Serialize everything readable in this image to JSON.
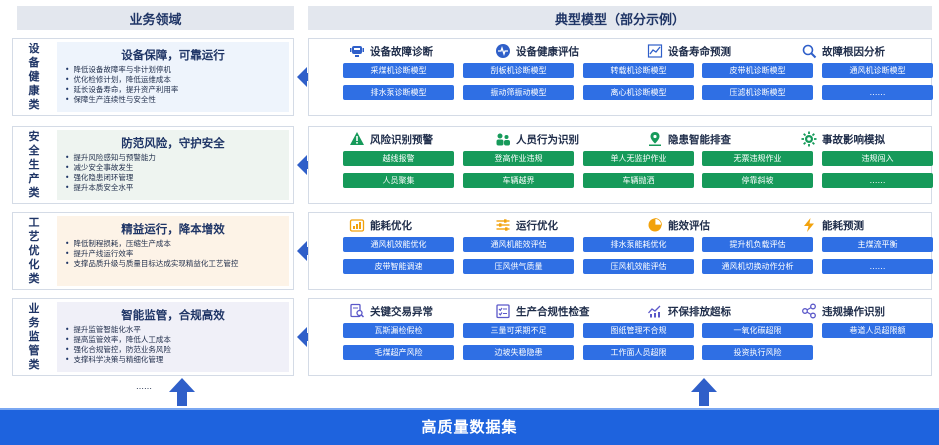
{
  "headers": {
    "left": "业务领域",
    "right": "典型模型（部分示例）"
  },
  "rows": [
    {
      "category": "设备健康类",
      "title": "设备保障，可靠运行",
      "bullets": [
        "降低设备故障率与非计划停机",
        "优化检修计划，降低运维成本",
        "延长设备寿命，提升资产利用率",
        "保障生产连续性与安全性"
      ],
      "theme": "blue",
      "models": [
        {
          "label": "设备故障诊断",
          "icon": "monitor-alert-icon"
        },
        {
          "label": "设备健康评估",
          "icon": "heartbeat-icon"
        },
        {
          "label": "设备寿命预测",
          "icon": "line-chart-icon"
        },
        {
          "label": "故障根因分析",
          "icon": "magnifier-icon"
        }
      ],
      "tags": [
        "采煤机诊断模型",
        "刮板机诊断模型",
        "转载机诊断模型",
        "皮带机诊断模型",
        "通风机诊断模型",
        "排水泵诊断模型",
        "振动筛振动模型",
        "离心机诊断模型",
        "压滤机诊断模型",
        "……"
      ]
    },
    {
      "category": "安全生产类",
      "title": "防范风险，守护安全",
      "bullets": [
        "提升风险感知与预警能力",
        "减少安全事故发生",
        "强化隐患闭环管理",
        "提升本质安全水平"
      ],
      "theme": "green",
      "models": [
        {
          "label": "风险识别预警",
          "icon": "warning-icon"
        },
        {
          "label": "人员行为识别",
          "icon": "people-icon"
        },
        {
          "label": "隐患智能排查",
          "icon": "map-pin-icon"
        },
        {
          "label": "事故影响模拟",
          "icon": "gear-burst-icon"
        }
      ],
      "tags": [
        "越线报警",
        "登高作业违规",
        "单人无监护作业",
        "无票违规作业",
        "违规闯入",
        "人员聚集",
        "车辆越界",
        "车辆抛洒",
        "停靠斜坡",
        "……"
      ]
    },
    {
      "category": "工艺优化类",
      "title": "精益运行，降本增效",
      "bullets": [
        "降低制程损耗，压缩生产成本",
        "提升产线运行效率",
        "支撑品质升级与质量目标达成实现精益化工艺管控"
      ],
      "theme": "blue",
      "models": [
        {
          "label": "能耗优化",
          "icon": "bar-chart-icon"
        },
        {
          "label": "运行优化",
          "icon": "sliders-icon"
        },
        {
          "label": "能效评估",
          "icon": "pie-chart-icon"
        },
        {
          "label": "能耗预测",
          "icon": "lightning-icon"
        }
      ],
      "tags": [
        "通风机效能优化",
        "通风机能效评估",
        "排水泵能耗优化",
        "提升机负载评估",
        "主煤流平衡",
        "皮带智能调速",
        "压风供气质量",
        "压风机效能评估",
        "通风机切换动作分析",
        "……"
      ]
    },
    {
      "category": "业务监管类",
      "title": "智能监管，合规高效",
      "bullets": [
        "提升监管智能化水平",
        "提高监管效率，降低人工成本",
        "强化合规管控，防范业务风险",
        "支撑科学决策与精细化管理"
      ],
      "theme": "blue",
      "models": [
        {
          "label": "关键交易异常",
          "icon": "document-search-icon"
        },
        {
          "label": "生产合规性检查",
          "icon": "checklist-icon"
        },
        {
          "label": "环保排放超标",
          "icon": "emission-chart-icon"
        },
        {
          "label": "违规操作识别",
          "icon": "network-icon"
        }
      ],
      "tags": [
        "瓦斯漏检假检",
        "三量可采期不足",
        "图纸管理不合规",
        "一氧化碳超限",
        "巷道人员超限额",
        "毛煤超产风险",
        "边坡失稳隐患",
        "工作面人员超限",
        "投资执行风险",
        ""
      ]
    }
  ],
  "left_more": "……",
  "bottom_label": "高质量数据集",
  "colors": {
    "blue": "#2f6fe4",
    "green": "#169a5a",
    "bottom": "#1e63de",
    "arrow": "#2f5fc9"
  }
}
